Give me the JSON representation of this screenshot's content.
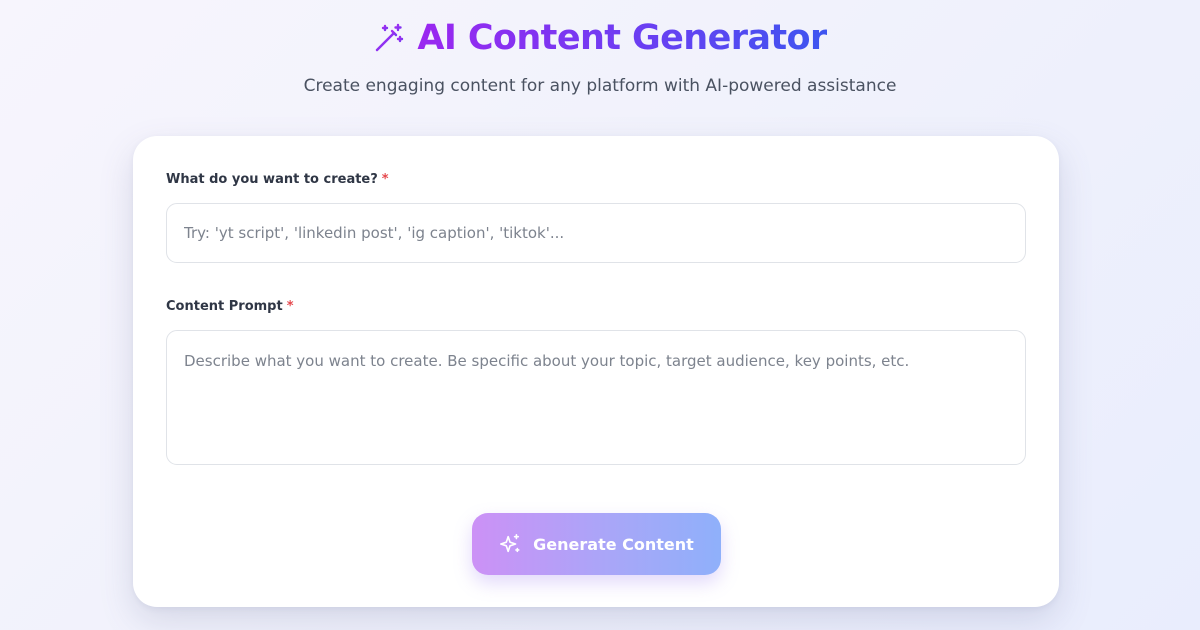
{
  "header": {
    "icon": "magic-wand-icon",
    "title": "AI Content Generator",
    "subtitle": "Create engaging content for any platform with AI-powered assistance"
  },
  "form": {
    "content_type": {
      "label": "What do you want to create?",
      "required_mark": "*",
      "value": "",
      "placeholder": "Try: 'yt script', 'linkedin post', 'ig caption', 'tiktok'..."
    },
    "prompt": {
      "label": "Content Prompt",
      "required_mark": "*",
      "value": "",
      "placeholder": "Describe what you want to create. Be specific about your topic, target audience, key points, etc."
    },
    "generate_button": {
      "icon": "sparkles-icon",
      "label": "Generate Content"
    }
  },
  "colors": {
    "title_gradient": [
      "#9b27f0",
      "#3d55f0"
    ],
    "button_gradient": [
      "#cc91f6",
      "#8fb0fa"
    ],
    "required": "#e5484d"
  }
}
